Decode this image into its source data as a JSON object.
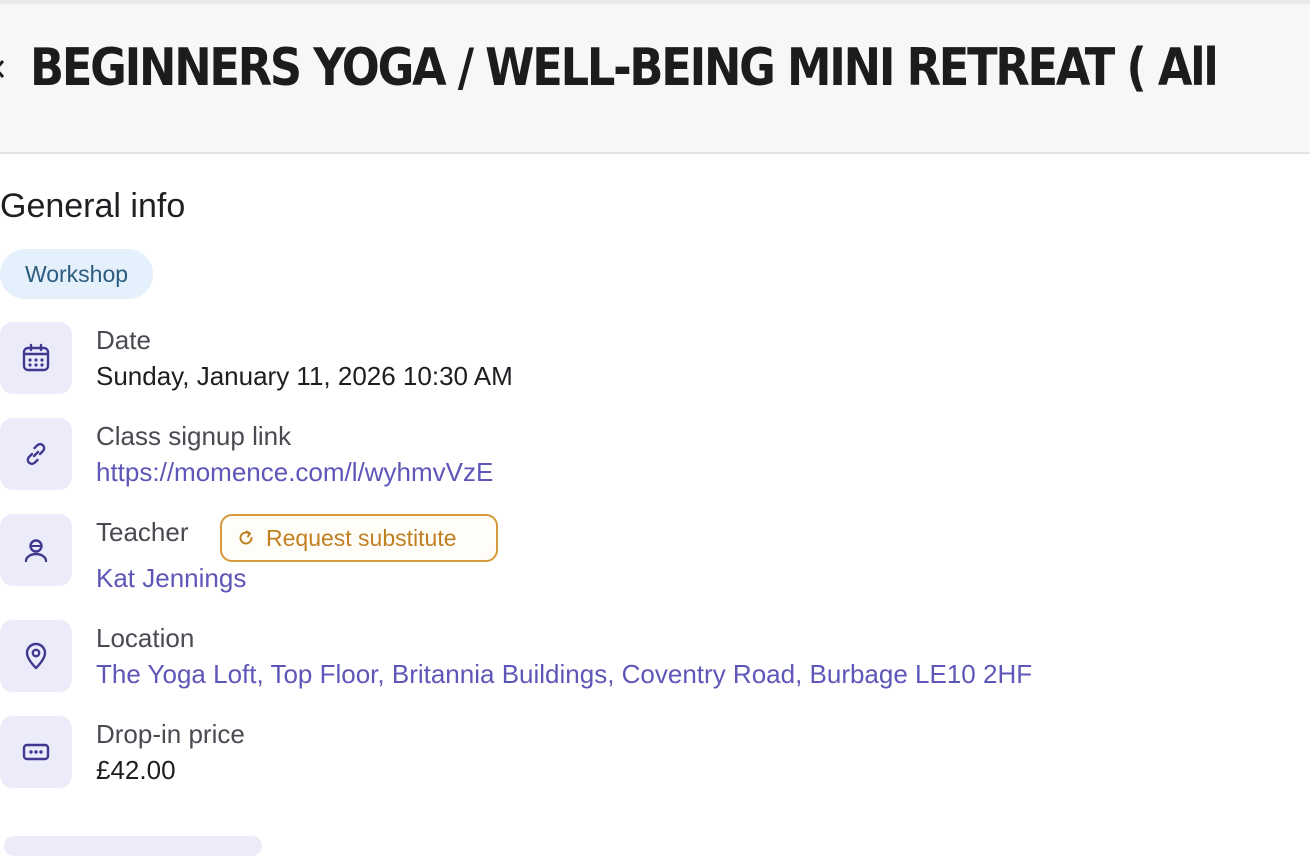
{
  "header": {
    "title": "BEGINNERS YOGA / WELL-BEING MINI RETREAT ( All",
    "back_icon": "chevron-left-icon"
  },
  "general_info": {
    "section_title": "General info",
    "tag": "Workshop",
    "rows": {
      "date": {
        "label": "Date",
        "value": "Sunday, January 11, 2026 10:30 AM",
        "icon": "calendar-icon"
      },
      "signup": {
        "label": "Class signup link",
        "value": "https://momence.com/l/wyhmvVzE",
        "icon": "link-icon"
      },
      "teacher": {
        "label": "Teacher",
        "value": "Kat Jennings",
        "icon": "user-icon",
        "action_label": "Request substitute",
        "action_icon": "refresh-icon"
      },
      "location": {
        "label": "Location",
        "value": "The Yoga Loft, Top Floor, Britannia Buildings, Coventry Road, Burbage LE10 2HF",
        "icon": "map-pin-icon"
      },
      "price": {
        "label": "Drop-in price",
        "value": "£42.00",
        "icon": "ticket-icon"
      }
    }
  },
  "colors": {
    "accent": "#5e56b8",
    "icon_bg": "#ecebfa",
    "tag_bg": "#e4f0fb",
    "tag_text": "#2b5b7e",
    "warning": "#d79a3a"
  }
}
